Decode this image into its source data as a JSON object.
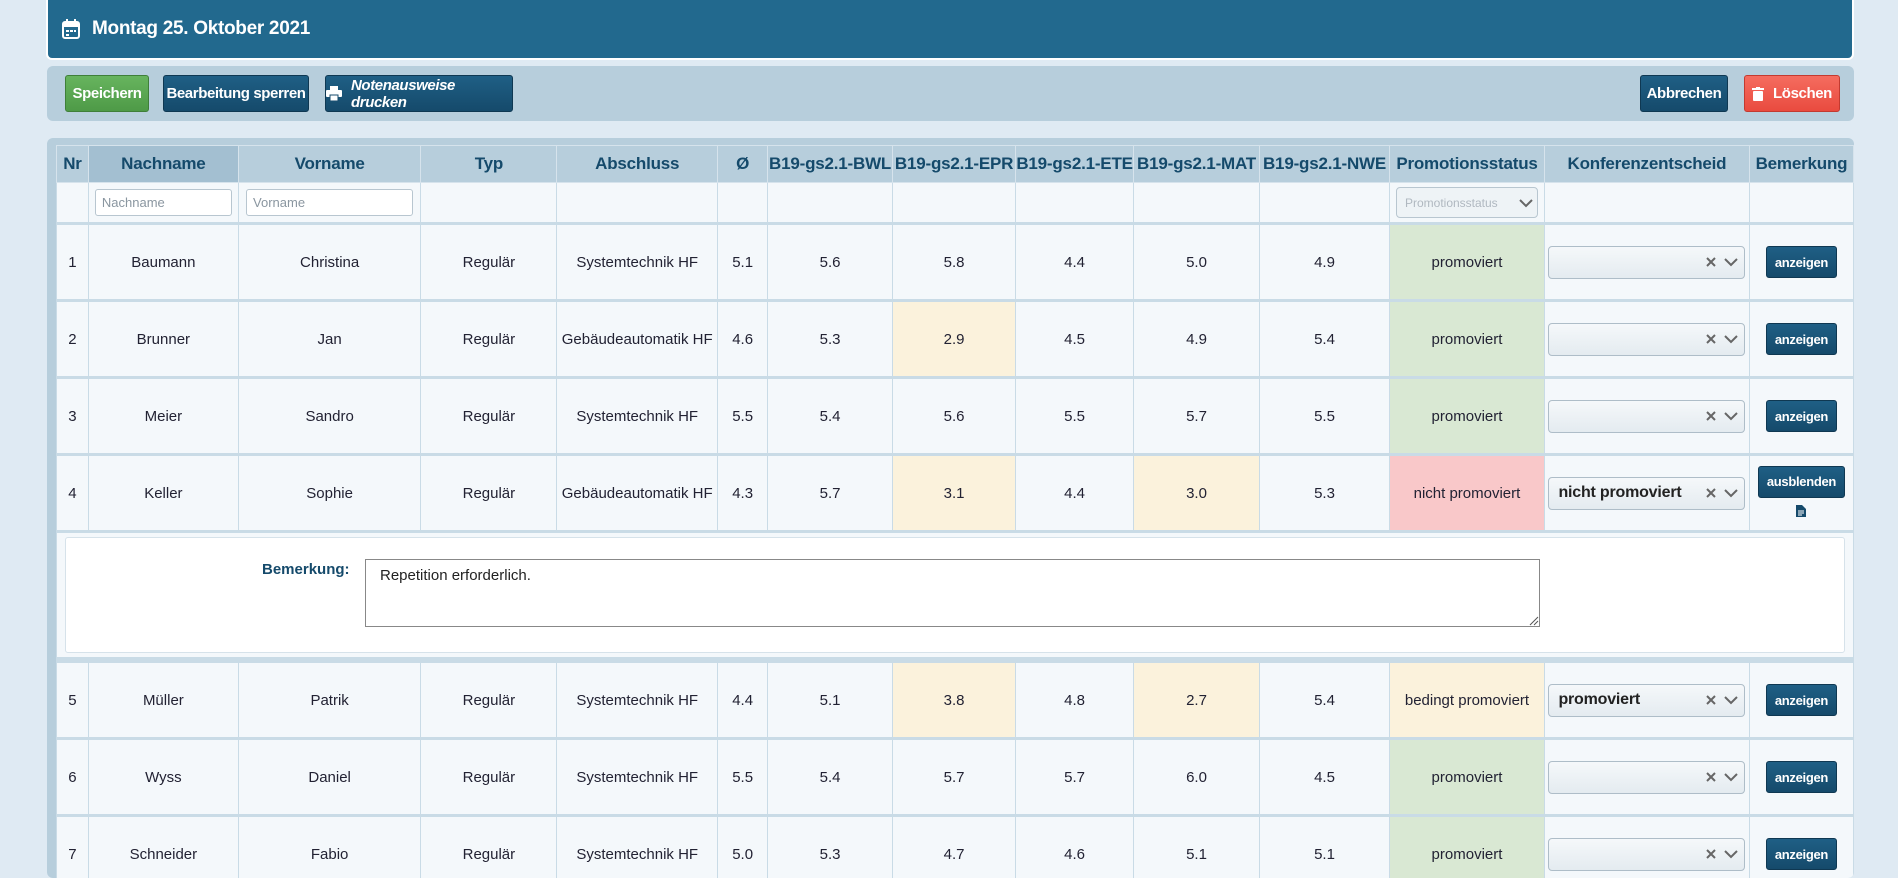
{
  "header": {
    "title": "Montag 25. Oktober 2021",
    "icon": "calendar-icon"
  },
  "toolbar": {
    "save": "Speichern",
    "lock": "Bearbeitung sperren",
    "print": "Notenausweise drucken",
    "cancel": "Abbrechen",
    "delete": "Löschen"
  },
  "table": {
    "headers": [
      "Nr",
      "Nachname",
      "Vorname",
      "Typ",
      "Abschluss",
      "Ø",
      "B19-gs2.1-BWL",
      "B19-gs2.1-EPR",
      "B19-gs2.1-ETE",
      "B19-gs2.1-MAT",
      "B19-gs2.1-NWE",
      "Promotionsstatus",
      "Konferenzentscheid",
      "Bemerkung"
    ],
    "filters": {
      "nachname": "Nachname",
      "vorname": "Vorname",
      "status": "Promotionsstatus"
    },
    "rows": [
      {
        "nr": "1",
        "nachname": "Baumann",
        "vorname": "Christina",
        "typ": "Regulär",
        "abschluss": "Systemtechnik HF",
        "avg": "5.1",
        "bwl": "5.6",
        "epr": "5.8",
        "ete": "4.4",
        "mat": "5.0",
        "nwe": "4.9",
        "status": "promoviert",
        "entscheid": "",
        "action": "anzeigen"
      },
      {
        "nr": "2",
        "nachname": "Brunner",
        "vorname": "Jan",
        "typ": "Regulär",
        "abschluss": "Gebäudeautomatik HF",
        "avg": "4.6",
        "bwl": "5.3",
        "epr": "2.9",
        "ete": "4.5",
        "mat": "4.9",
        "nwe": "5.4",
        "status": "promoviert",
        "entscheid": "",
        "action": "anzeigen"
      },
      {
        "nr": "3",
        "nachname": "Meier",
        "vorname": "Sandro",
        "typ": "Regulär",
        "abschluss": "Systemtechnik HF",
        "avg": "5.5",
        "bwl": "5.4",
        "epr": "5.6",
        "ete": "5.5",
        "mat": "5.7",
        "nwe": "5.5",
        "status": "promoviert",
        "entscheid": "",
        "action": "anzeigen"
      },
      {
        "nr": "4",
        "nachname": "Keller",
        "vorname": "Sophie",
        "typ": "Regulär",
        "abschluss": "Gebäudeautomatik HF",
        "avg": "4.3",
        "bwl": "5.7",
        "epr": "3.1",
        "ete": "4.4",
        "mat": "3.0",
        "nwe": "5.3",
        "status": "nicht promoviert",
        "entscheid": "nicht promoviert",
        "action": "ausblenden"
      },
      {
        "nr": "5",
        "nachname": "Müller",
        "vorname": "Patrik",
        "typ": "Regulär",
        "abschluss": "Systemtechnik HF",
        "avg": "4.4",
        "bwl": "5.1",
        "epr": "3.8",
        "ete": "4.8",
        "mat": "2.7",
        "nwe": "5.4",
        "status": "bedingt promoviert",
        "entscheid": "promoviert",
        "action": "anzeigen"
      },
      {
        "nr": "6",
        "nachname": "Wyss",
        "vorname": "Daniel",
        "typ": "Regulär",
        "abschluss": "Systemtechnik HF",
        "avg": "5.5",
        "bwl": "5.4",
        "epr": "5.7",
        "ete": "5.7",
        "mat": "6.0",
        "nwe": "4.5",
        "status": "promoviert",
        "entscheid": "",
        "action": "anzeigen"
      },
      {
        "nr": "7",
        "nachname": "Schneider",
        "vorname": "Fabio",
        "typ": "Regulär",
        "abschluss": "Systemtechnik HF",
        "avg": "5.0",
        "bwl": "5.3",
        "epr": "4.7",
        "ete": "4.6",
        "mat": "5.1",
        "nwe": "5.1",
        "status": "promoviert",
        "entscheid": "",
        "action": "anzeigen"
      }
    ],
    "remark": {
      "label": "Bemerkung:",
      "text": "Repetition erforderlich."
    }
  },
  "colors": {
    "header": "#22698e",
    "ok": "#d9e8d3",
    "warn": "#fbf2dc",
    "bad": "#f9c8c9",
    "green": "#5aa752",
    "red": "#ee5b4e"
  }
}
